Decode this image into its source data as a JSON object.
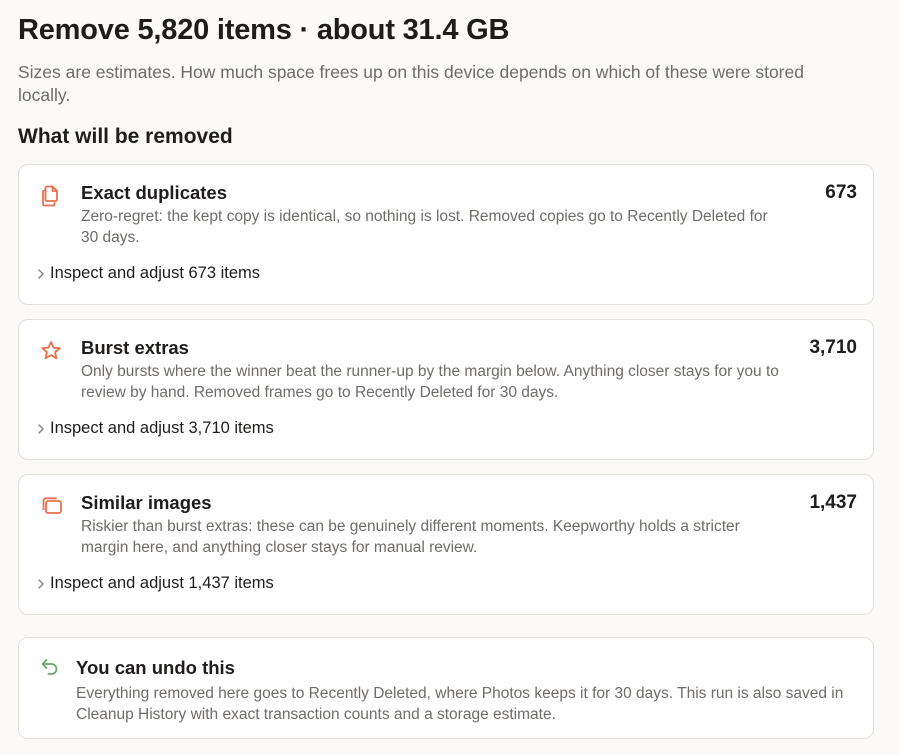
{
  "header": {
    "title": "Remove 5,820 items · about 31.4 GB",
    "subtitle": "Sizes are estimates. How much space frees up on this device depends on which of these were stored locally."
  },
  "section": {
    "heading": "What will be removed"
  },
  "categories": [
    {
      "icon": "duplicate-pages-icon",
      "title": "Exact duplicates",
      "count": "673",
      "description": "Zero-regret: the kept copy is identical, so nothing is lost. Removed copies go to Recently Deleted for 30 days.",
      "inspect_label": "Inspect and adjust 673 items"
    },
    {
      "icon": "burst-star-icon",
      "title": "Burst extras",
      "count": "3,710",
      "description": "Only bursts where the winner beat the runner-up by the margin below. Anything closer stays for you to review by hand. Removed frames go to Recently Deleted for 30 days.",
      "inspect_label": "Inspect and adjust 3,710 items"
    },
    {
      "icon": "similar-images-icon",
      "title": "Similar images",
      "count": "1,437",
      "description": "Riskier than burst extras: these can be genuinely different moments. Keepworthy holds a stricter margin here, and anything closer stays for manual review.",
      "inspect_label": "Inspect and adjust 1,437 items"
    }
  ],
  "undo": {
    "icon": "undo-arrow-icon",
    "title": "You can undo this",
    "description": "Everything removed here goes to Recently Deleted, where Photos keeps it for 30 days. This run is also saved in Cleanup History with exact transaction counts and a storage estimate."
  },
  "colors": {
    "accent": "#e8704d",
    "undo_accent": "#6aa86a",
    "muted_text": "#6f6c69",
    "card_border": "#e3e0dc"
  }
}
